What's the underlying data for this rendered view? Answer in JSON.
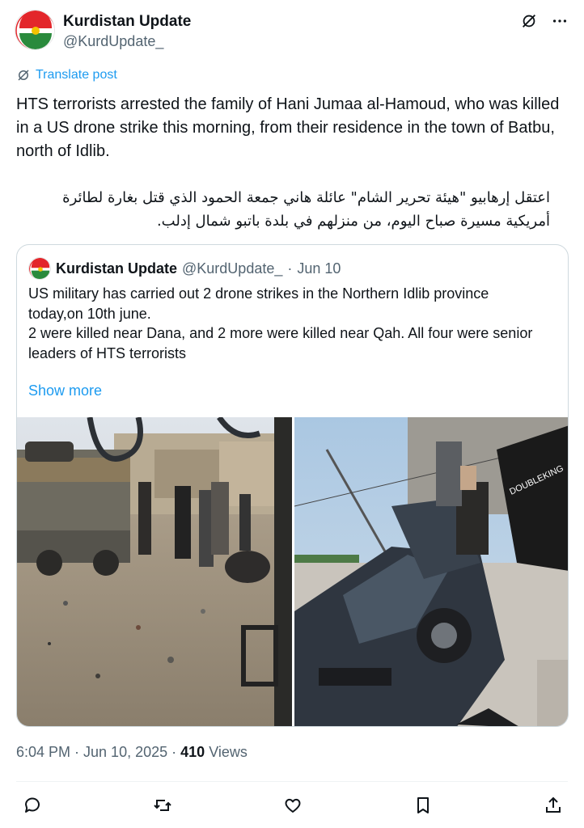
{
  "post": {
    "author": {
      "display_name": "Kurdistan Update",
      "handle": "@KurdUpdate_",
      "avatar": "kurdistan-flag-seal",
      "avatar_seal_text_top": "YEKÎTIYA KURDAN",
      "avatar_seal_text_bottom": "UNITY OF THE KURDS"
    },
    "translate_label": "Translate post",
    "text_en": "HTS terrorists arrested the family of Hani Jumaa al-Hamoud, who was killed in a US drone strike this morning, from their residence in the town of Batbu, north of Idlib.",
    "text_ar": "اعتقل إرهابيو \"هيئة تحرير الشام\" عائلة هاني جمعة الحمود الذي قتل بغارة لطائرة أمريكية مسيرة صباح اليوم، من منزلهم في بلدة باتبو شمال إدلب.",
    "timestamp": "6:04 PM · Jun 10, 2025",
    "views_count": "410",
    "views_label": "Views"
  },
  "quote": {
    "display_name": "Kurdistan Update",
    "handle": "@KurdUpdate_",
    "separator": "·",
    "date": "Jun 10",
    "lines": [
      "US military has carried out 2 drone strikes in the Northern Idlib province",
      "today,on 10th june.",
      "2  were killed near Dana, and 2 more were killed near Qah. All four were senior",
      "leaders of HTS terrorists"
    ],
    "show_more": "Show more",
    "images": [
      {
        "alt": "street-scene-after-strike"
      },
      {
        "alt": "damaged-car"
      }
    ],
    "logo_text_on_image": "DOUBLEKING"
  },
  "icons": {
    "header": [
      "grok-icon",
      "more-icon"
    ],
    "actions": [
      "reply-icon",
      "repost-icon",
      "like-icon",
      "bookmark-icon",
      "share-icon"
    ]
  },
  "colors": {
    "link": "#1d9bf0",
    "text": "#0f1419",
    "secondary": "#536471",
    "border": "#cfd9de",
    "flag_red": "#e3262b",
    "flag_green": "#2a8a3c",
    "flag_sun": "#f4c300"
  }
}
